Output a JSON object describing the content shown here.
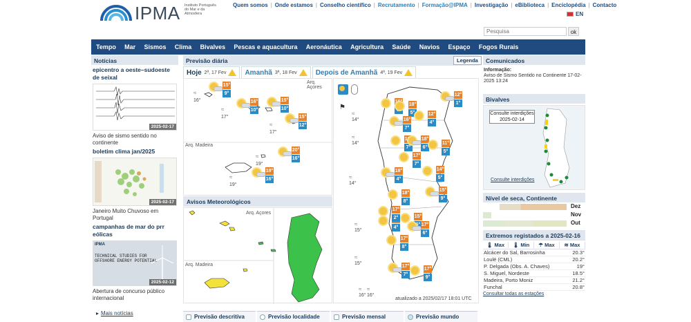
{
  "header": {
    "brand": "IPMA",
    "subtitle": "Instituto Português do Mar e da Atmosfera",
    "top_links": [
      "Quem somos",
      "Onde estamos",
      "Conselho científico",
      "Recrutamento",
      "Formação@IPMA",
      "Investigação",
      "eBiblioteca",
      "Enciclopédia",
      "Contacto"
    ],
    "lang": "EN",
    "search_placeholder": "Pesquisa",
    "search_button": "ok"
  },
  "mainnav": [
    "Tempo",
    "Mar",
    "Sismos",
    "Clima",
    "Bivalves",
    "Pescas e aquacultura",
    "Aeronáutica",
    "Agricultura",
    "Saúde",
    "Navios",
    "Espaço",
    "Fogos Rurais"
  ],
  "news": {
    "heading": "Notícias",
    "items": [
      {
        "title": "epicentro a oeste–sudoeste de seixal",
        "date": "2025-02-17",
        "caption": "Aviso de sismo sentido no continente"
      },
      {
        "title": "boletim clima jan/2025",
        "date": "2025-02-17",
        "caption": "Janeiro Muito Chuvoso em Portugal"
      },
      {
        "title": "campanhas de mar do prr eólicas",
        "date": "2025-02-12",
        "caption": "Abertura de concurso público internacional",
        "img_text": "TECHNICAL STUDIES FOR OFFSHORE ENERGY POTENTIAL"
      }
    ],
    "more": "Mais notícias"
  },
  "forecast": {
    "heading": "Previsão diária",
    "legend_button": "Legenda",
    "tabs": [
      {
        "label": "Hoje",
        "date": "2ª, 17 Fev"
      },
      {
        "label": "Amanhã",
        "date": "3ª, 18 Fev"
      },
      {
        "label": "Depois de Amanhã",
        "date": "4ª, 19 Fev"
      }
    ],
    "region_acores": "Arq. Açores",
    "region_madeira": "Arq. Madeira",
    "acores": [
      {
        "max": "15°",
        "min": "9°",
        "sea": "16°"
      },
      {
        "max": "16°",
        "min": "10°",
        "sea": "17°"
      },
      {
        "max": "15°",
        "min": "10°"
      },
      {
        "max": "15°",
        "min": "12°",
        "sea": "17°"
      }
    ],
    "madeira": [
      {
        "max": "20°",
        "min": "16°",
        "sea": "19°"
      },
      {
        "max": "19°",
        "min": "16°",
        "sea": "19°"
      }
    ],
    "continent": [
      {
        "max": "12°",
        "min": "1°"
      },
      {
        "max": "16°",
        "min": "7°"
      },
      {
        "max": "18°",
        "min": "5°"
      },
      {
        "max": "16°",
        "min": "7°"
      },
      {
        "max": "12°",
        "min": "4°"
      },
      {
        "max": "18°",
        "min": "7°"
      },
      {
        "max": "18°",
        "min": "6°"
      },
      {
        "max": "11°",
        "min": "5°"
      },
      {
        "max": "17°",
        "min": "7°"
      },
      {
        "max": "18°",
        "min": "4°"
      },
      {
        "max": "14°",
        "min": "5°"
      },
      {
        "max": "18°",
        "min": "8°"
      },
      {
        "max": "15°",
        "min": "9°"
      },
      {
        "max": "15°",
        "min": "6°"
      },
      {
        "max": "17°",
        "min": "4°"
      },
      {
        "max": "17°",
        "min": "6°"
      },
      {
        "max": "17°",
        "min": "8°"
      },
      {
        "max": "17°",
        "min": "2°"
      },
      {
        "max": "17°",
        "min": "7°"
      },
      {
        "max": "17°",
        "min": "9°"
      }
    ],
    "sea_temps": [
      "14°",
      "14°",
      "14°",
      "15°",
      "15°",
      "16°",
      "16°"
    ],
    "updated": "atualizado a 2025/02/17 18:01 UTC"
  },
  "avisos": {
    "heading": "Avisos Meteorológicos",
    "region_acores": "Arq. Açores",
    "region_madeira": "Arq. Madeira",
    "colors": {
      "green": "#3cc24a",
      "yellow": "#f3e23a"
    }
  },
  "bottom_tabs": [
    "Previsão descritiva",
    "Previsão localidade",
    "Previsão mensal",
    "Previsão mundo"
  ],
  "right": {
    "comunicados_heading": "Comunicados",
    "comunicado_label": "Informação:",
    "comunicado_text": "Aviso de Sismo Sentido no Continente 17-02-2025 13:24",
    "bivalves_heading": "Bivalves",
    "bivalves_box": "Consulte interdições 2025-02-14",
    "bivalves_link": "Consulte interdições",
    "seca_heading": "Nível de seca, Continente",
    "seca_rows": [
      "Dez",
      "Nov",
      "Out"
    ],
    "extremes_heading": "Extremos registados a 2025-02-16",
    "extremes_cols": [
      "Max",
      "Min",
      "Max",
      "Max"
    ],
    "extremes": [
      {
        "place": "Alcácer do Sal, Barrosinha",
        "value": "20.3°"
      },
      {
        "place": "Loulé (CML)",
        "value": "20.2°"
      },
      {
        "place": "P. Delgada (Obs. A. Chaves)",
        "value": "19°"
      },
      {
        "place": "S. Miguel, Nordeste",
        "value": "18.5°"
      },
      {
        "place": "Madeira, Porto Moniz",
        "value": "21.2°"
      },
      {
        "place": "Funchal",
        "value": "20.8°"
      }
    ],
    "extremes_more": "Consultar todas as estações"
  }
}
